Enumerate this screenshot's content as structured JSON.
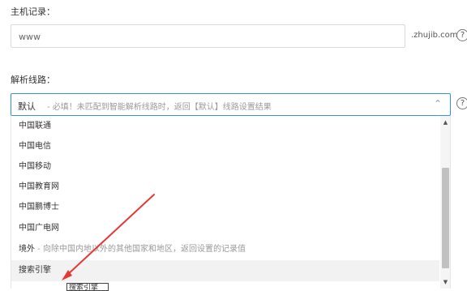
{
  "host_record": {
    "label": "主机记录：",
    "value": "www",
    "suffix": ".zhujib.com",
    "help": "?"
  },
  "route": {
    "label": "解析线路：",
    "selected": "默认",
    "hint": " - 必填！未匹配到智能解析线路时，返回【默认】线路设置结果",
    "help": "?",
    "options": [
      {
        "label": "中国联通",
        "desc": ""
      },
      {
        "label": "中国电信",
        "desc": ""
      },
      {
        "label": "中国移动",
        "desc": ""
      },
      {
        "label": "中国教育网",
        "desc": ""
      },
      {
        "label": "中国鹏博士",
        "desc": ""
      },
      {
        "label": "中国广电网",
        "desc": ""
      },
      {
        "label": "境外",
        "desc": " - 向除中国内地以外的其他国家和地区，返回设置的记录值"
      },
      {
        "label": "搜索引擎",
        "desc": ""
      }
    ]
  },
  "tooltip": "搜索引擎",
  "colors": {
    "focus_border": "#3a8fdd",
    "annotation_arrow": "#e53935"
  }
}
